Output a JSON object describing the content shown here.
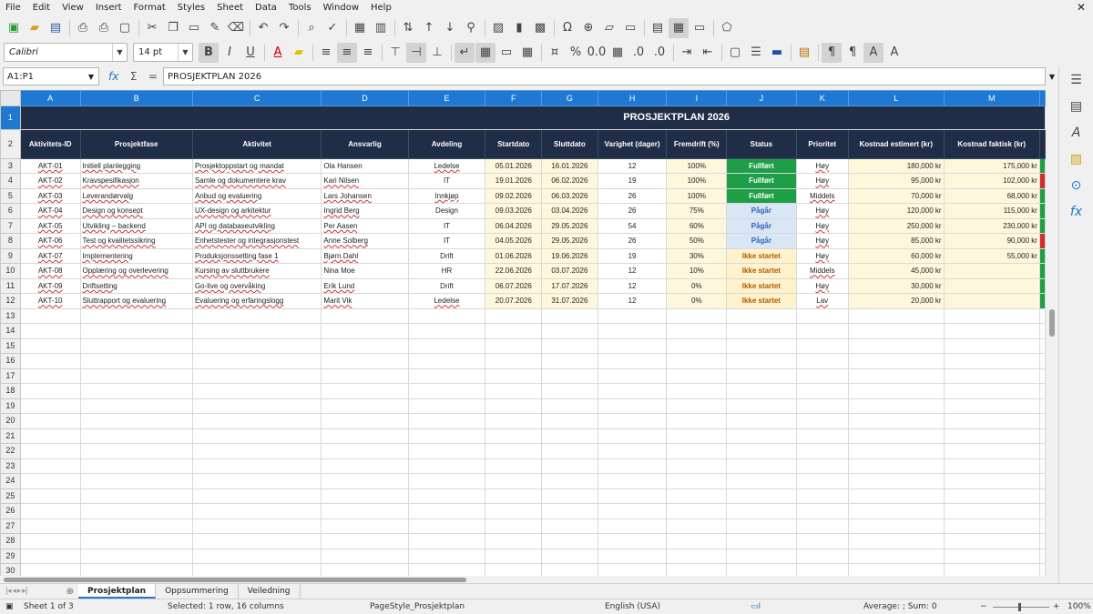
{
  "menu": [
    "File",
    "Edit",
    "View",
    "Insert",
    "Format",
    "Styles",
    "Sheet",
    "Data",
    "Tools",
    "Window",
    "Help"
  ],
  "font": {
    "name": "Calibri",
    "size": "14 pt"
  },
  "name_box": "A1:P1",
  "formula": "PROSJEKTPLAN 2026",
  "columns": [
    "A",
    "B",
    "C",
    "D",
    "E",
    "F",
    "G",
    "H",
    "I",
    "J",
    "K",
    "L",
    "M"
  ],
  "title": "PROSJEKTPLAN 2026",
  "headers": [
    "Aktivitets-ID",
    "Prosjektfase",
    "Aktivitet",
    "Ansvarlig",
    "Avdeling",
    "Startdato",
    "Sluttdato",
    "Varighet (dager)",
    "Fremdrift (%)",
    "Status",
    "Prioritet",
    "Kostnad estimert (kr)",
    "Kostnad faktisk (kr)"
  ],
  "rows": [
    [
      "AKT-01",
      "Initiell planlegging",
      "Prosjektoppstart og mandat",
      "Ola Hansen",
      "Ledelse",
      "05.01.2026",
      "16.01.2026",
      "12",
      "100%",
      "Fullført",
      "Høy",
      "180,000 kr",
      "175,000 kr"
    ],
    [
      "AKT-02",
      "Kravspesifikasjon",
      "Samle og dokumentere krav",
      "Kari Nilsen",
      "IT",
      "19.01.2026",
      "06.02.2026",
      "19",
      "100%",
      "Fullført",
      "Høy",
      "95,000 kr",
      "102,000 kr"
    ],
    [
      "AKT-03",
      "Leverandørvalg",
      "Anbud og evaluering",
      "Lars Johansen",
      "Innkjøp",
      "09.02.2026",
      "06.03.2026",
      "26",
      "100%",
      "Fullført",
      "Middels",
      "70,000 kr",
      "68,000 kr"
    ],
    [
      "AKT-04",
      "Design og konsept",
      "UX-design og arkitektur",
      "Ingrid Berg",
      "Design",
      "09.03.2026",
      "03.04.2026",
      "26",
      "75%",
      "Pågår",
      "Høy",
      "120,000 kr",
      "115,000 kr"
    ],
    [
      "AKT-05",
      "Utvikling – backend",
      "API og databaseutvikling",
      "Per Aasen",
      "IT",
      "06.04.2026",
      "29.05.2026",
      "54",
      "60%",
      "Pågår",
      "Høy",
      "250,000 kr",
      "230,000 kr"
    ],
    [
      "AKT-06",
      "Test og kvalitetssikring",
      "Enhetstester og integrasjonstest",
      "Anne Solberg",
      "IT",
      "04.05.2026",
      "29.05.2026",
      "26",
      "50%",
      "Pågår",
      "Høy",
      "85,000 kr",
      "90,000 kr"
    ],
    [
      "AKT-07",
      "Implementering",
      "Produksjonssetting fase 1",
      "Bjørn Dahl",
      "Drift",
      "01.06.2026",
      "19.06.2026",
      "19",
      "30%",
      "Ikke startet",
      "Høy",
      "60,000 kr",
      "55,000 kr"
    ],
    [
      "AKT-08",
      "Opplæring og overlevering",
      "Kursing av sluttbrukere",
      "Nina Moe",
      "HR",
      "22.06.2026",
      "03.07.2026",
      "12",
      "10%",
      "Ikke startet",
      "Middels",
      "45,000 kr",
      ""
    ],
    [
      "AKT-09",
      "Driftsetting",
      "Go-live og overvåking",
      "Erik Lund",
      "Drift",
      "06.07.2026",
      "17.07.2026",
      "12",
      "0%",
      "Ikke startet",
      "Høy",
      "30,000 kr",
      ""
    ],
    [
      "AKT-10",
      "Sluttrapport og evaluering",
      "Evaluering og erfaringslogg",
      "Marit Vik",
      "Ledelse",
      "20.07.2026",
      "31.07.2026",
      "12",
      "0%",
      "Ikke startet",
      "Lav",
      "20,000 kr",
      ""
    ]
  ],
  "indicator": [
    "green",
    "red",
    "green",
    "green",
    "green",
    "red",
    "green",
    "green",
    "green",
    "green"
  ],
  "sheets": [
    "Prosjektplan",
    "Oppsummering",
    "Veiledning"
  ],
  "active_sheet": 0,
  "status": {
    "sheet": "Sheet 1 of 3",
    "selection": "Selected: 1 row, 16 columns",
    "page_style": "PageStyle_Prosjektplan",
    "language": "English (USA)",
    "summary": "Average: ; Sum: 0",
    "zoom": "100%"
  },
  "colors": {
    "header_bg": "#1f2d46",
    "done": "#1e9e46",
    "progress": "#d9e6f6",
    "not_started": "#fff2cc",
    "accent": "#1f78d1"
  }
}
